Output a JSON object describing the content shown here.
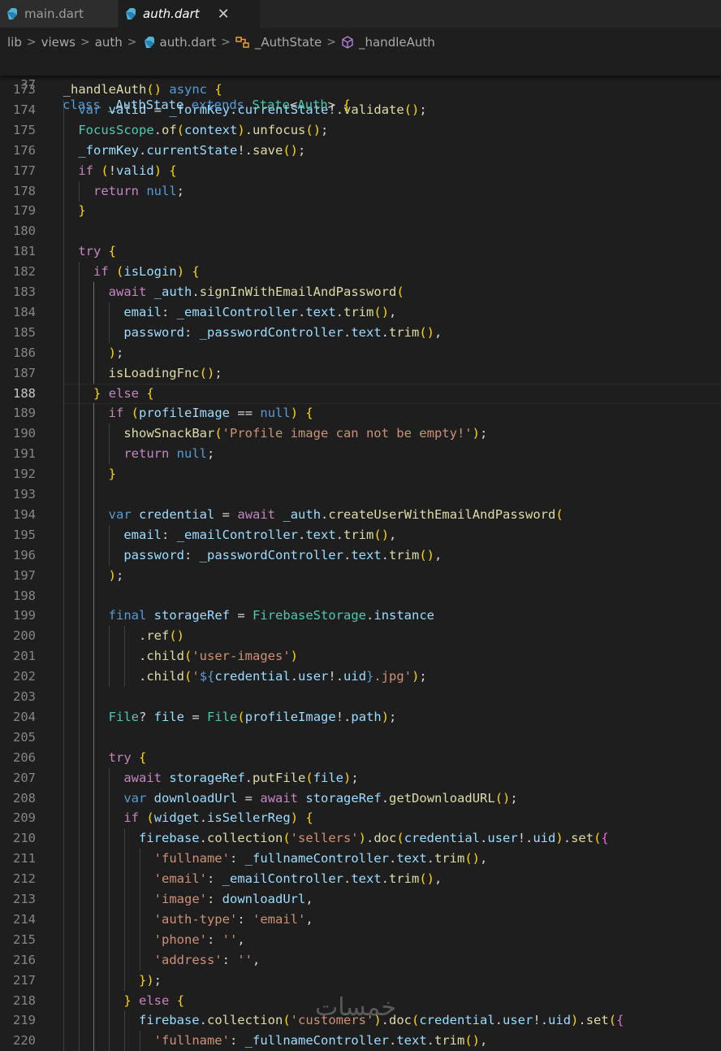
{
  "tabs": [
    {
      "label": "main.dart",
      "active": false
    },
    {
      "label": "auth.dart",
      "active": true
    }
  ],
  "close_glyph": "✕",
  "breadcrumb": {
    "items": [
      "lib",
      "views",
      "auth",
      "auth.dart",
      "_AuthState",
      "_handleAuth"
    ],
    "separator": ">"
  },
  "sticky": {
    "line_number": "37",
    "code": "class _AuthState extends State<Auth> {"
  },
  "current_line": 188,
  "watermark": "خمسات",
  "editor_lines": [
    {
      "n": "173",
      "code": "  _handleAuth() async {"
    },
    {
      "n": "174",
      "code": "    var valid = _formKey.currentState!.validate();"
    },
    {
      "n": "175",
      "code": "    FocusScope.of(context).unfocus();"
    },
    {
      "n": "176",
      "code": "    _formKey.currentState!.save();"
    },
    {
      "n": "177",
      "code": "    if (!valid) {"
    },
    {
      "n": "178",
      "code": "      return null;"
    },
    {
      "n": "179",
      "code": "    }"
    },
    {
      "n": "180",
      "code": ""
    },
    {
      "n": "181",
      "code": "    try {"
    },
    {
      "n": "182",
      "code": "      if (isLogin) {"
    },
    {
      "n": "183",
      "code": "        await _auth.signInWithEmailAndPassword("
    },
    {
      "n": "184",
      "code": "          email: _emailController.text.trim(),"
    },
    {
      "n": "185",
      "code": "          password: _passwordController.text.trim(),"
    },
    {
      "n": "186",
      "code": "        );"
    },
    {
      "n": "187",
      "code": "        isLoadingFnc();"
    },
    {
      "n": "188",
      "code": "      } else {"
    },
    {
      "n": "189",
      "code": "        if (profileImage == null) {"
    },
    {
      "n": "190",
      "code": "          showSnackBar('Profile image can not be empty!');"
    },
    {
      "n": "191",
      "code": "          return null;"
    },
    {
      "n": "192",
      "code": "        }"
    },
    {
      "n": "193",
      "code": ""
    },
    {
      "n": "194",
      "code": "        var credential = await _auth.createUserWithEmailAndPassword("
    },
    {
      "n": "195",
      "code": "          email: _emailController.text.trim(),"
    },
    {
      "n": "196",
      "code": "          password: _passwordController.text.trim(),"
    },
    {
      "n": "197",
      "code": "        );"
    },
    {
      "n": "198",
      "code": ""
    },
    {
      "n": "199",
      "code": "        final storageRef = FirebaseStorage.instance"
    },
    {
      "n": "200",
      "code": "            .ref()"
    },
    {
      "n": "201",
      "code": "            .child('user-images')"
    },
    {
      "n": "202",
      "code": "            .child('${credential.user!.uid}.jpg');"
    },
    {
      "n": "203",
      "code": ""
    },
    {
      "n": "204",
      "code": "        File? file = File(profileImage!.path);"
    },
    {
      "n": "205",
      "code": ""
    },
    {
      "n": "206",
      "code": "        try {"
    },
    {
      "n": "207",
      "code": "          await storageRef.putFile(file);"
    },
    {
      "n": "208",
      "code": "          var downloadUrl = await storageRef.getDownloadURL();"
    },
    {
      "n": "209",
      "code": "          if (widget.isSellerReg) {"
    },
    {
      "n": "210",
      "code": "            firebase.collection('sellers').doc(credential.user!.uid).set({"
    },
    {
      "n": "211",
      "code": "              'fullname': _fullnameController.text.trim(),"
    },
    {
      "n": "212",
      "code": "              'email': _emailController.text.trim(),"
    },
    {
      "n": "213",
      "code": "              'image': downloadUrl,"
    },
    {
      "n": "214",
      "code": "              'auth-type': 'email',"
    },
    {
      "n": "215",
      "code": "              'phone': '',"
    },
    {
      "n": "216",
      "code": "              'address': '',"
    },
    {
      "n": "217",
      "code": "            });"
    },
    {
      "n": "218",
      "code": "          } else {"
    },
    {
      "n": "219",
      "code": "            firebase.collection('customers').doc(credential.user!.uid).set({"
    },
    {
      "n": "220",
      "code": "              'fullname': _fullnameController.text.trim(),"
    }
  ]
}
